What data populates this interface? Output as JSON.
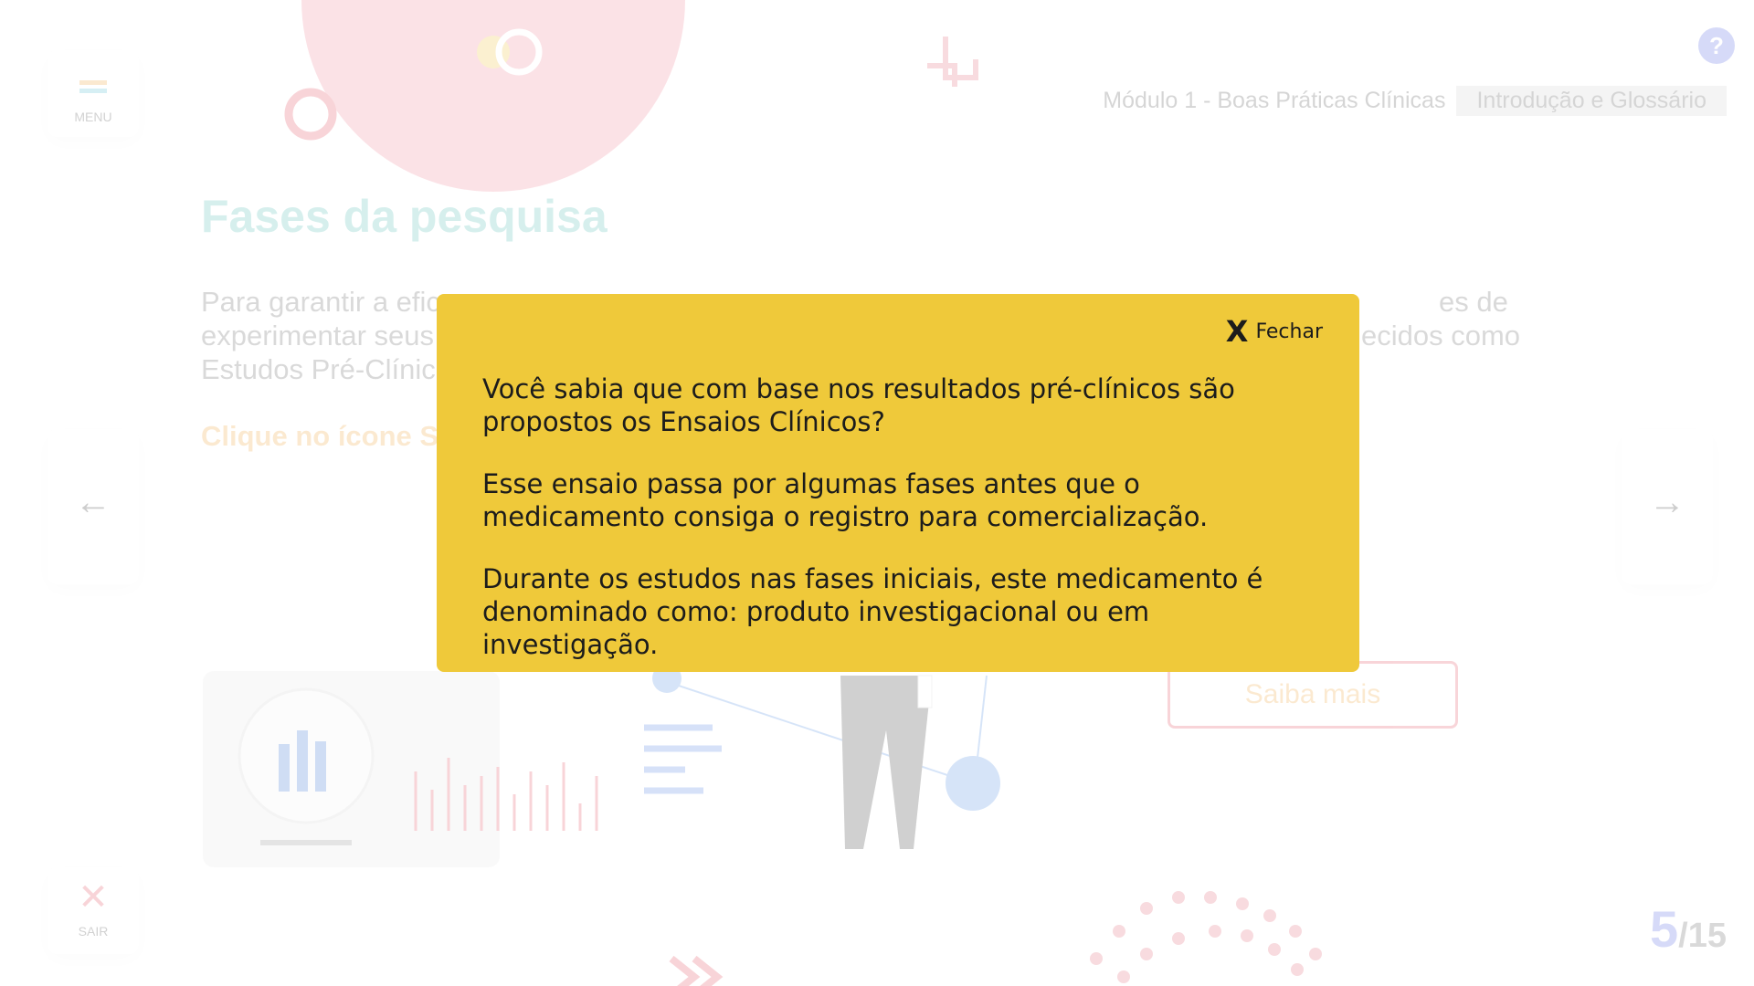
{
  "header": {
    "breadcrumb_module": "Módulo 1 - Boas Práticas Clínicas",
    "breadcrumb_section": "Introdução e Glossário",
    "help_label": "?"
  },
  "menu": {
    "label": "MENU",
    "icon": "hamburger-icon"
  },
  "exit": {
    "label": "SAIR",
    "icon": "close-icon"
  },
  "content": {
    "title": "Fases da pesquisa",
    "paragraph_line1": "Para garantir a efic",
    "paragraph_line1_end": "es de",
    "paragraph_line2": "experimentar seus",
    "paragraph_line2_end": "ecidos como",
    "paragraph_line3": "Estudos Pré-Clínic",
    "instruction": "Clique no ícone Sa",
    "saiba_mais": "Saiba mais"
  },
  "pagination": {
    "current": "5",
    "total": "/15"
  },
  "popup": {
    "close_label": "Fechar",
    "close_icon_text": "X",
    "paragraphs": [
      "Você sabia que com base nos resultados pré-clínicos são propostos os Ensaios Clínicos?",
      "Esse ensaio passa por algumas fases antes que o medicamento consiga o registro para comercialização.",
      "Durante os estudos nas fases iniciais, este medicamento é denominado como: produto investigacional ou em investigação."
    ]
  },
  "colors": {
    "popup_bg": "#efc93a",
    "title": "#48b8b0",
    "accent_orange": "#f0a030",
    "accent_pink": "#e07880",
    "accent_blue": "#4a5ae0"
  }
}
